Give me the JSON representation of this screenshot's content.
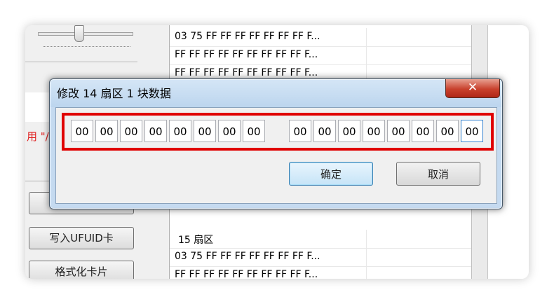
{
  "left_panel": {
    "red_text": "用 \"/",
    "buttons": [
      {
        "label": "写入UFUID卡"
      },
      {
        "label": "格式化卡片"
      }
    ]
  },
  "sector_list": {
    "rows": [
      {
        "text": "03 75 FF FF FF FF FF FF FF F..."
      },
      {
        "text": "FF FF FF FF FF FF FF FF FF F..."
      },
      {
        "text": "FF FF FF FF FF FF FF FF FF F..."
      },
      {
        "text": "15 扇区"
      },
      {
        "text": "03 75 FF FF FF FF FF FF FF F..."
      },
      {
        "text": "FF FF FF FF FF FF FF FF FF F..."
      }
    ]
  },
  "dialog": {
    "title": "修改 14 扇区 1 块数据",
    "close_label": "✕",
    "hex_group1": [
      "00",
      "00",
      "00",
      "00",
      "00",
      "00",
      "00",
      "00"
    ],
    "hex_group2": [
      "00",
      "00",
      "00",
      "00",
      "00",
      "00",
      "00",
      "00"
    ],
    "ok_label": "确定",
    "cancel_label": "取消"
  },
  "colors": {
    "highlight_border": "#e00000",
    "close_button": "#c8402c",
    "red_text": "#e02020"
  }
}
